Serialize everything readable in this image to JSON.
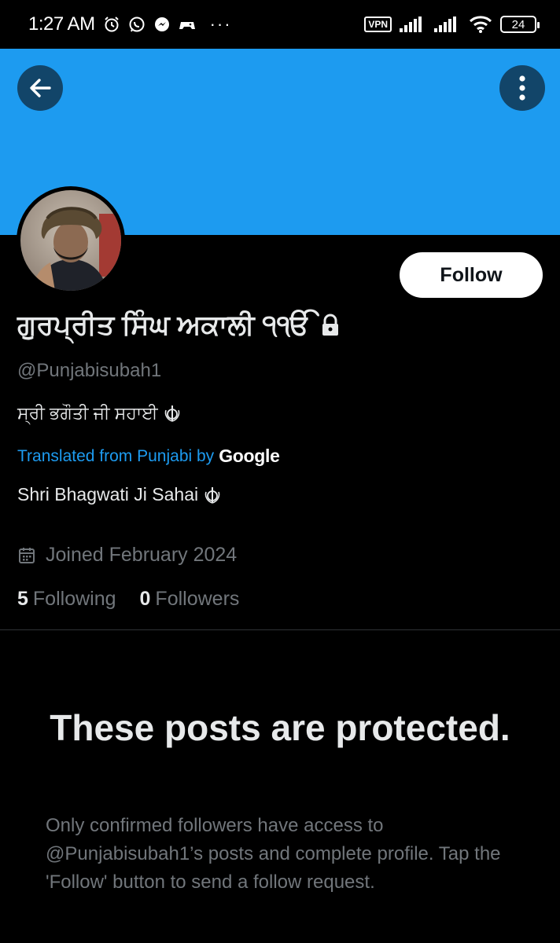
{
  "status_bar": {
    "time": "1:27 AM",
    "vpn": "VPN",
    "battery": "24",
    "overflow": "···"
  },
  "profile": {
    "display_name": "ਗੁਰਪ੍ਰੀਤ ਸਿੰਘ ਅਕਾਲੀ ੧ੴ",
    "handle": "@Punjabisubah1",
    "bio": "ਸ੍ਰੀ ਭਗੌਤੀ ਜੀ ਸਹਾਈ",
    "translated_label": "Translated from Punjabi by",
    "translator": "Google",
    "bio_translation": "Shri Bhagwati Ji Sahai",
    "joined": "Joined February 2024",
    "following_count": "5",
    "following_label": "Following",
    "followers_count": "0",
    "followers_label": "Followers",
    "follow_label": "Follow"
  },
  "protected": {
    "title": "These posts are protected.",
    "body": "Only confirmed followers have access to @Punjabisubah1’s posts and complete profile. Tap the 'Follow' button to send a follow request."
  },
  "colors": {
    "banner": "#1d9bf0",
    "accent": "#1d9bf0",
    "background": "#000000"
  }
}
